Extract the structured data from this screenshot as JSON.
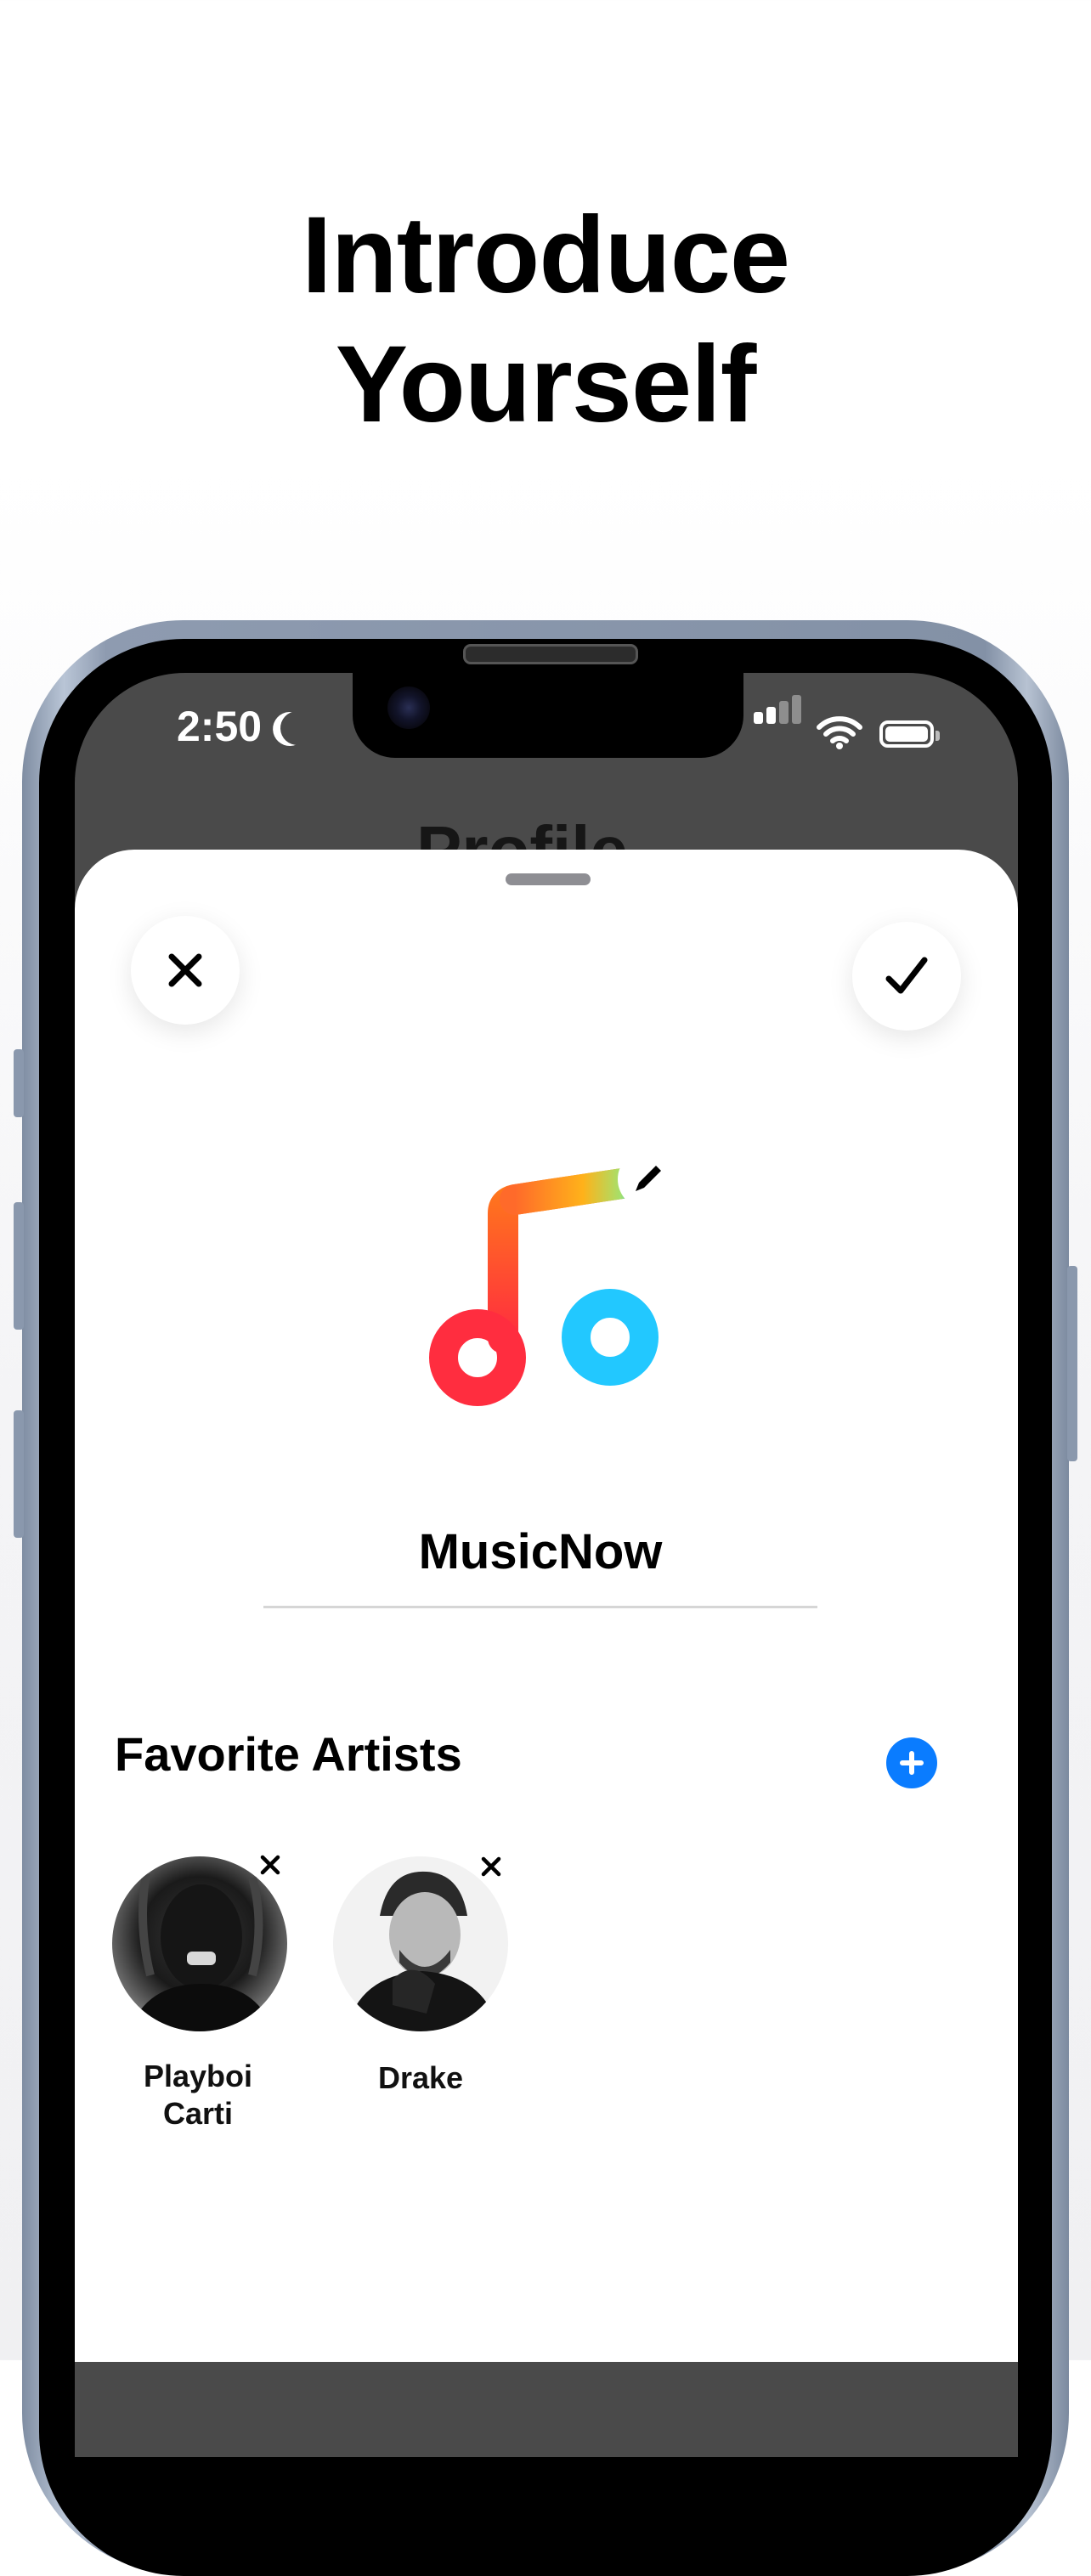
{
  "headline": {
    "line1": "Introduce",
    "line2": "Yourself"
  },
  "status_bar": {
    "time": "2:50"
  },
  "background_screen": {
    "title": "Profile"
  },
  "sheet": {
    "close_icon": "close-icon",
    "confirm_icon": "checkmark-icon",
    "name_value": "MusicNow",
    "favorites": {
      "title": "Favorite Artists",
      "artists": [
        {
          "name_line1": "Playboi",
          "name_line2": "Carti"
        },
        {
          "name_line1": "Drake",
          "name_line2": ""
        }
      ]
    }
  },
  "colors": {
    "accent_blue": "#0a7cff",
    "logo_red": "#ff2d3f",
    "logo_orange": "#ffa21a",
    "logo_blue": "#1cc4ff"
  }
}
